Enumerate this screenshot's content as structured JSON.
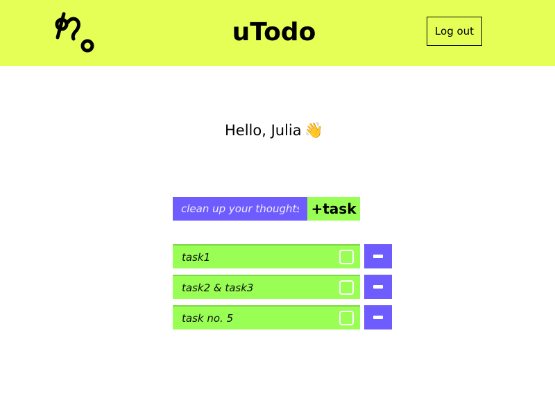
{
  "header": {
    "app_title": "uTodo",
    "logout_label": "Log out",
    "logo_icon": "utodo-logo-icon"
  },
  "main": {
    "greeting_text": "Hello, Julia",
    "greeting_emoji": "👋",
    "new_task": {
      "placeholder": "clean up your thoughts",
      "value": "",
      "add_label": "+task"
    },
    "tasks": [
      {
        "label": "task1",
        "done": false
      },
      {
        "label": "task2 & task3",
        "done": false
      },
      {
        "label": "task no. 5",
        "done": false
      }
    ]
  },
  "colors": {
    "header_bg": "#e6ff57",
    "accent_purple": "#6f5cff",
    "accent_green": "#99ff55"
  }
}
